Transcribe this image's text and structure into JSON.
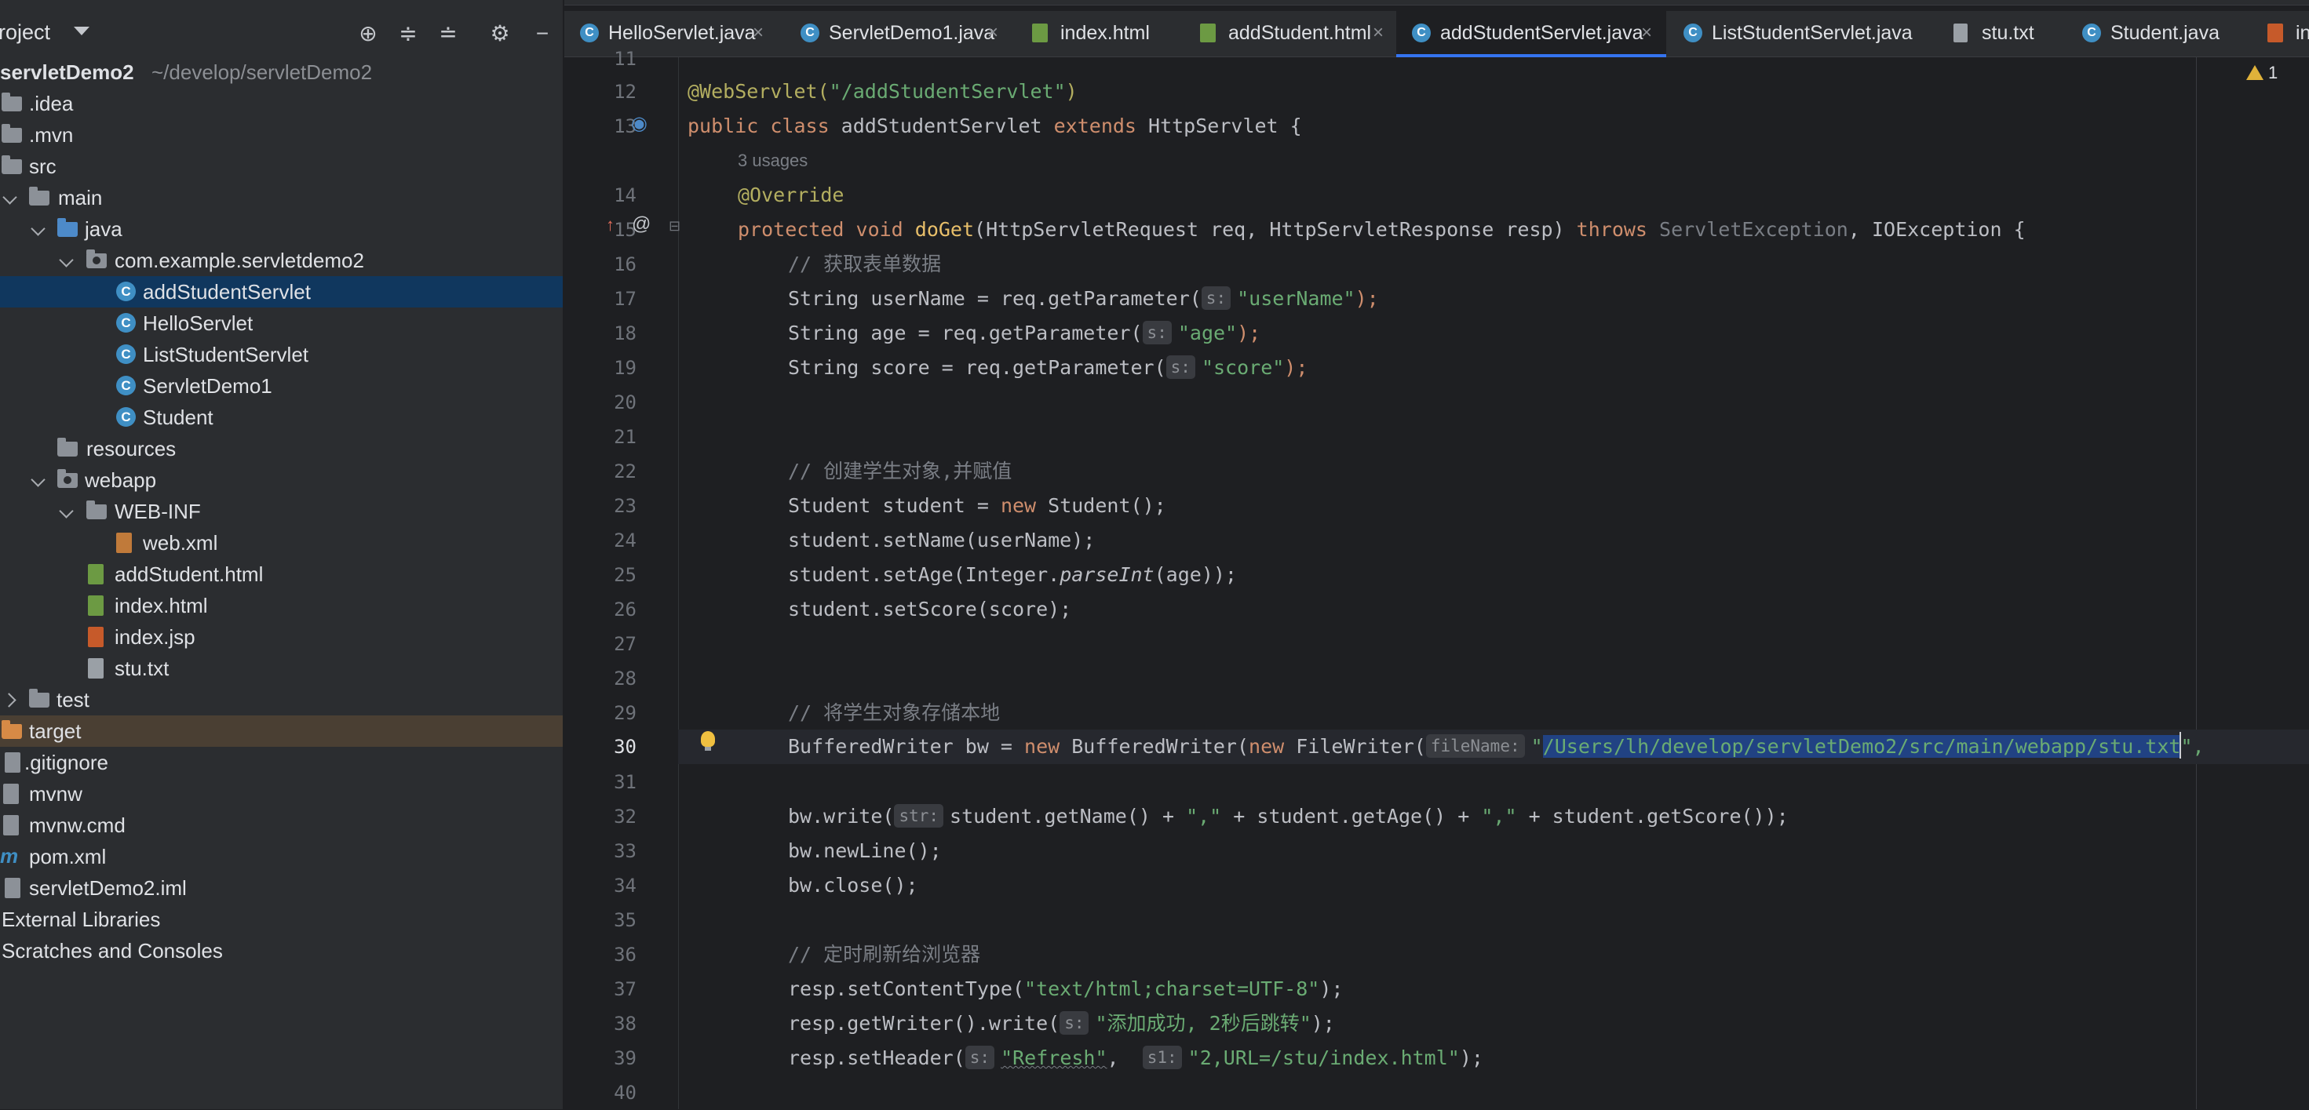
{
  "project_panel": {
    "title": "roject",
    "tree": [
      {
        "label": "servletDemo2",
        "sub": "~/develop/servletDemo2",
        "bold": true
      },
      {
        "label": ".idea"
      },
      {
        "label": ".mvn"
      },
      {
        "label": "src"
      },
      {
        "label": "main"
      },
      {
        "label": "java"
      },
      {
        "label": "com.example.servletdemo2"
      },
      {
        "label": "addStudentServlet"
      },
      {
        "label": "HelloServlet"
      },
      {
        "label": "ListStudentServlet"
      },
      {
        "label": "ServletDemo1"
      },
      {
        "label": "Student"
      },
      {
        "label": "resources"
      },
      {
        "label": "webapp"
      },
      {
        "label": "WEB-INF"
      },
      {
        "label": "web.xml"
      },
      {
        "label": "addStudent.html"
      },
      {
        "label": "index.html"
      },
      {
        "label": "index.jsp"
      },
      {
        "label": "stu.txt"
      },
      {
        "label": "test"
      },
      {
        "label": "target"
      },
      {
        "label": ".gitignore"
      },
      {
        "label": "mvnw"
      },
      {
        "label": "mvnw.cmd"
      },
      {
        "label": "pom.xml"
      },
      {
        "label": "servletDemo2.iml"
      },
      {
        "label": "External Libraries"
      },
      {
        "label": "Scratches and Consoles"
      }
    ]
  },
  "tabs": [
    {
      "label": "HelloServlet.java",
      "icon": "java-class-icon"
    },
    {
      "label": "ServletDemo1.java",
      "icon": "java-class-icon"
    },
    {
      "label": "index.html",
      "icon": "html-file-icon"
    },
    {
      "label": "addStudent.html",
      "icon": "html-file-icon"
    },
    {
      "label": "addStudentServlet.java",
      "icon": "java-class-icon",
      "active": true
    },
    {
      "label": "ListStudentServlet.java",
      "icon": "java-class-icon"
    },
    {
      "label": "stu.txt",
      "icon": "text-file-icon"
    },
    {
      "label": "Student.java",
      "icon": "java-class-icon"
    },
    {
      "label": "in",
      "icon": "jsp-file-icon"
    }
  ],
  "editor": {
    "line_numbers": [
      "11",
      "12",
      "13",
      "14",
      "15",
      "16",
      "17",
      "18",
      "19",
      "20",
      "21",
      "22",
      "23",
      "24",
      "25",
      "26",
      "27",
      "28",
      "29",
      "30",
      "31",
      "32",
      "33",
      "34",
      "35",
      "36",
      "37",
      "38",
      "39",
      "40"
    ],
    "current_line": "30",
    "usages": "3 usages",
    "hints": {
      "s": "s:",
      "fileName": "fileName:",
      "str": "str:",
      "s1": "s1:"
    },
    "code": {
      "l12_ann": "@WebServlet(",
      "l12_str": "\"/addStudentServlet\"",
      "l12_end": ")",
      "l13_kw1": "public class ",
      "l13_name": "addStudentServlet ",
      "l13_kw2": "extends ",
      "l13_rest": "HttpServlet {",
      "l14": "@Override",
      "l15_kw": "protected void ",
      "l15_fn": "doGet",
      "l15_params": "(HttpServletRequest req, HttpServletResponse resp) ",
      "l15_throws": "throws ",
      "l15_exc": "ServletException",
      "l15_rest": ", IOException {",
      "l16": "// 获取表单数据",
      "l17_a": "String userName = req.getParameter(",
      "l17_s": "\"userName\"",
      "l17_b": ");",
      "l18_a": "String age = req.getParameter(",
      "l18_s": "\"age\"",
      "l18_b": ");",
      "l19_a": "String score = req.getParameter(",
      "l19_s": "\"score\"",
      "l19_b": ");",
      "l22": "// 创建学生对象,并赋值",
      "l23_a": "Student student = ",
      "l23_kw": "new ",
      "l23_b": "Student();",
      "l24": "student.setName(userName);",
      "l25_a": "student.setAge(Integer.",
      "l25_it": "parseInt",
      "l25_b": "(age));",
      "l26": "student.setScore(score);",
      "l29": "// 将学生对象存储本地",
      "l30_a": "BufferedWriter bw = ",
      "l30_kw1": "new ",
      "l30_b": "BufferedWriter(",
      "l30_kw2": "new ",
      "l30_c": "FileWriter(",
      "l30_q": "\"",
      "l30_sel": "/Users/lh/develop/servletDemo2/src/main/webapp/stu.txt",
      "l30_end": "\", ",
      "l32_a": "bw.write(",
      "l32_b": "student.getName() + ",
      "l32_s1": "\",\"",
      "l32_c": " + student.getAge() + ",
      "l32_s2": "\",\"",
      "l32_d": " + student.getScore());",
      "l33": "bw.newLine();",
      "l34": "bw.close();",
      "l36": "// 定时刷新给浏览器",
      "l37_a": "resp.setContentType(",
      "l37_s": "\"text/html;charset=UTF-8\"",
      "l37_b": ");",
      "l38_a": "resp.getWriter().write(",
      "l38_s": "\"添加成功, 2秒后跳转\"",
      "l38_b": ");",
      "l39_a": "resp.setHeader(",
      "l39_s1": "\"Refresh\"",
      "l39_comma": ",  ",
      "l39_s2": "\"2,URL=/stu/index.html\"",
      "l39_b": ");"
    }
  },
  "inspections": {
    "warnings": "1"
  }
}
